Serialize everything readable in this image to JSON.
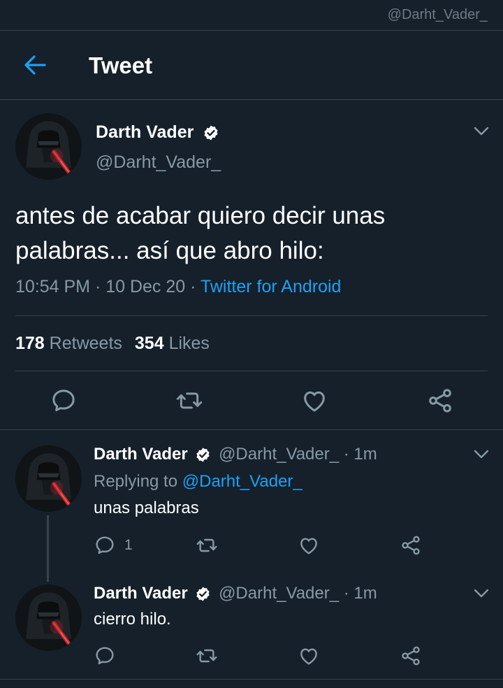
{
  "watermark": "@Darht_Vader_",
  "header": {
    "title": "Tweet"
  },
  "main": {
    "name": "Darth Vader",
    "handle": "@Darht_Vader_",
    "text_line1": "antes de acabar quiero decir unas",
    "text_line2": "palabras... así que abro hilo:",
    "time": "10:54 PM · 10 Dec 20 · ",
    "source": "Twitter for Android",
    "retweets_count": "178",
    "retweets_label": "Retweets",
    "likes_count": "354",
    "likes_label": "Likes"
  },
  "replies": [
    {
      "name": "Darth Vader",
      "handle": "@Darht_Vader_ · 1m",
      "replying_prefix": "Replying to ",
      "replying_to": "@Darht_Vader_",
      "text": "unas palabras",
      "reply_count": "1"
    },
    {
      "name": "Darth Vader",
      "handle": "@Darht_Vader_ · 1m",
      "text": "cierro hilo."
    }
  ],
  "colors": {
    "background": "#15202b",
    "accent": "#1da1f2",
    "muted": "#8899a6",
    "divider": "#38444d"
  },
  "icons": [
    "back-arrow-icon",
    "verified-badge-icon",
    "chevron-down-icon",
    "reply-icon",
    "retweet-icon",
    "like-icon",
    "share-icon"
  ]
}
